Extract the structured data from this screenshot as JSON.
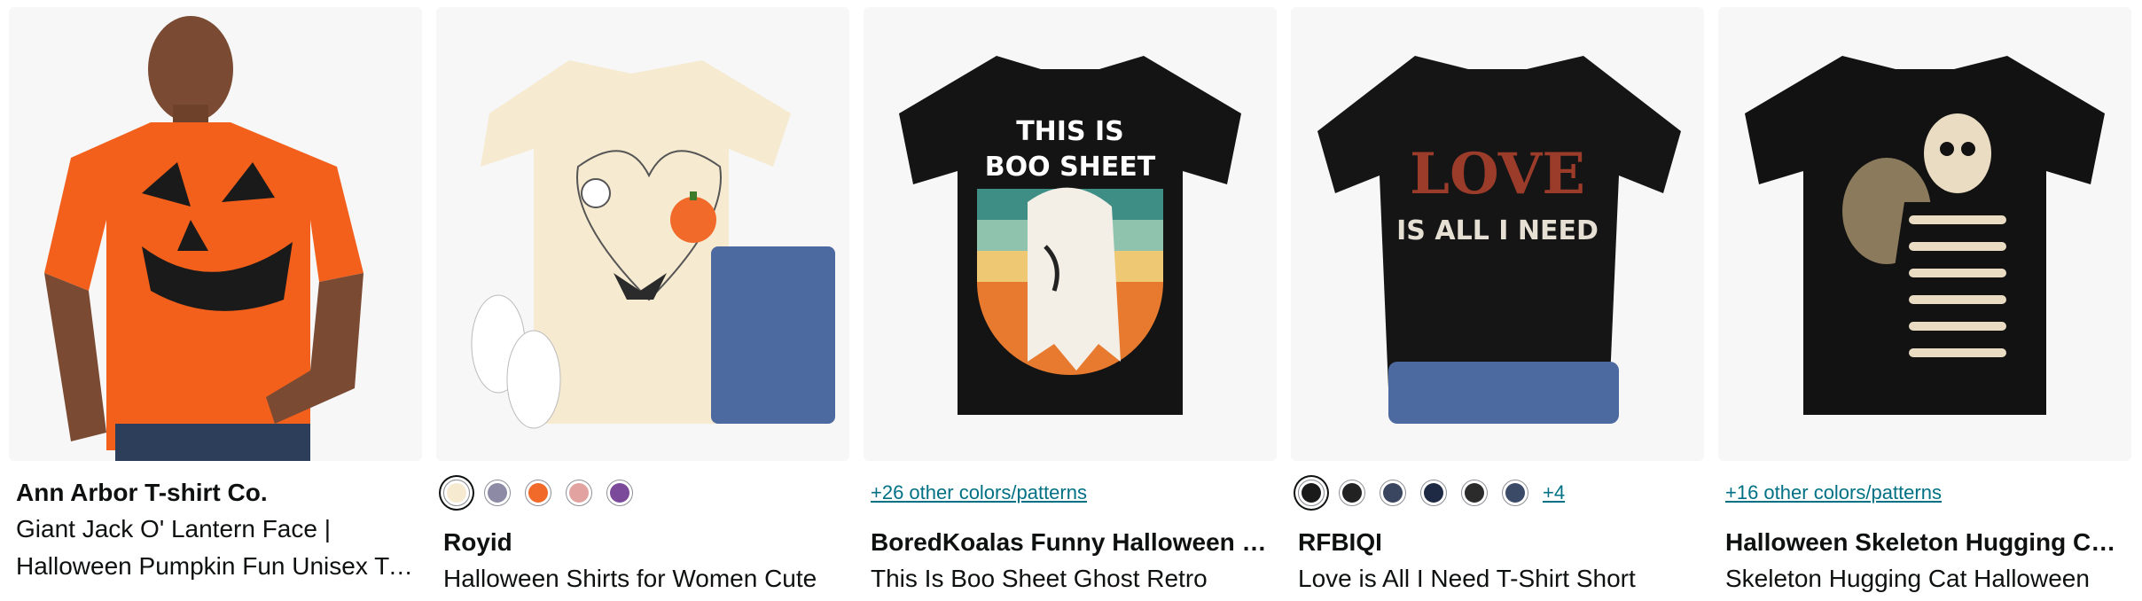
{
  "products": [
    {
      "brand": "Ann Arbor T-shirt Co.",
      "title": "Giant Jack O' Lantern Face | Halloween Pumpkin Fun Unisex T-Shirt",
      "image_icon": "orange-pumpkin-tshirt-model",
      "shirt_color": "#f2601c",
      "more_colors": ""
    },
    {
      "brand": "Royid",
      "title": "Halloween Shirts for Women Cute",
      "image_icon": "cream-halloween-heart-tshirt",
      "shirt_color": "#f6ead0",
      "swatch_colors": [
        "#f6ead0",
        "#8d8aa6",
        "#f26a2a",
        "#e2a3a0",
        "#7b4a9a"
      ],
      "more_colors": ""
    },
    {
      "brand": "BoredKoalas Funny Halloween Designs",
      "title": "This Is Boo Sheet Ghost Retro",
      "image_icon": "boo-sheet-ghost-tshirt",
      "shirt_color": "#141414",
      "shirt_text": [
        "THIS IS",
        "BOO SHEET"
      ],
      "more_colors": "+26 other colors/patterns"
    },
    {
      "brand": "RFBIQI",
      "title": "Love is All I Need T-Shirt Short",
      "image_icon": "love-is-all-i-need-tshirt",
      "shirt_color": "#151515",
      "shirt_text": [
        "LOVE",
        "IS ALL I NEED"
      ],
      "swatch_colors": [
        "#1a1a1a",
        "#222222",
        "#3a4660",
        "#1e2a44",
        "#2b2b2b",
        "#3b4a66"
      ],
      "swatch_more": "+4",
      "more_colors": ""
    },
    {
      "brand": "Halloween Skeleton Hugging Cat Gifts",
      "title": "Skeleton Hugging Cat Halloween",
      "image_icon": "skeleton-hugging-cat-tshirt",
      "shirt_color": "#121212",
      "more_colors": "+16 other colors/patterns"
    }
  ]
}
